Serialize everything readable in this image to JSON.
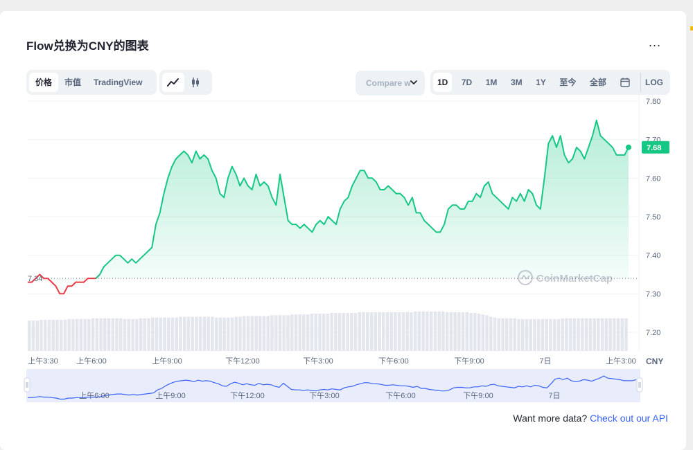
{
  "page": {
    "title": "Flow兑换为CNY的图表",
    "more_label": "..."
  },
  "tabs": [
    {
      "label": "价格",
      "active": true
    },
    {
      "label": "市值",
      "active": false
    },
    {
      "label": "TradingView",
      "active": false
    }
  ],
  "chart_types": [
    {
      "icon": "line-chart-icon",
      "active": true
    },
    {
      "icon": "candlestick-icon",
      "active": false
    }
  ],
  "compare": {
    "placeholder": "Compare w"
  },
  "ranges": [
    {
      "label": "1D",
      "active": true
    },
    {
      "label": "7D",
      "active": false
    },
    {
      "label": "1M",
      "active": false
    },
    {
      "label": "3M",
      "active": false
    },
    {
      "label": "1Y",
      "active": false
    },
    {
      "label": "至今",
      "active": false
    },
    {
      "label": "全部",
      "active": false
    },
    {
      "icon": "calendar-icon"
    },
    {
      "label": "LOG",
      "active": false
    }
  ],
  "colors": {
    "up": "#16c784",
    "down": "#ea3943",
    "nav_line": "#3861fb",
    "accent_link": "#3861fb"
  },
  "watermark": "CoinMarketCap",
  "api": {
    "text": "Want more data?",
    "link": "Check out our API"
  },
  "chart_data": {
    "type": "area",
    "currency": "CNY",
    "open_price": 7.34,
    "open_label": "7.34",
    "current_price": 7.68,
    "current_label": "7.68",
    "ylim": [
      7.16,
      7.82
    ],
    "yticks": [
      "7.80",
      "7.70",
      "7.60",
      "7.50",
      "7.40",
      "7.30",
      "7.20"
    ],
    "xticks": [
      "上午3:30",
      "上午6:00",
      "上午9:00",
      "下午12:00",
      "下午3:00",
      "下午6:00",
      "下午9:00",
      "7日",
      "上午3:00"
    ],
    "nav_xticks": [
      "上午6:00",
      "上午9:00",
      "下午12:00",
      "下午3:00",
      "下午6:00",
      "下午9:00",
      "7日"
    ],
    "series": [
      {
        "values": [
          7.33,
          7.33,
          7.34,
          7.35,
          7.34,
          7.34,
          7.33,
          7.32,
          7.3,
          7.3,
          7.32,
          7.32,
          7.33,
          7.33,
          7.33,
          7.34,
          7.34,
          7.34,
          7.35,
          7.37,
          7.38,
          7.39,
          7.4,
          7.4,
          7.39,
          7.38,
          7.39,
          7.38,
          7.39,
          7.4,
          7.41,
          7.42,
          7.48,
          7.51,
          7.56,
          7.6,
          7.63,
          7.65,
          7.66,
          7.67,
          7.66,
          7.64,
          7.67,
          7.65,
          7.66,
          7.65,
          7.62,
          7.6,
          7.56,
          7.55,
          7.6,
          7.63,
          7.61,
          7.58,
          7.6,
          7.58,
          7.57,
          7.61,
          7.58,
          7.59,
          7.58,
          7.55,
          7.53,
          7.61,
          7.55,
          7.49,
          7.48,
          7.48,
          7.47,
          7.48,
          7.47,
          7.46,
          7.48,
          7.49,
          7.48,
          7.5,
          7.49,
          7.48,
          7.52,
          7.54,
          7.55,
          7.58,
          7.6,
          7.62,
          7.62,
          7.6,
          7.6,
          7.59,
          7.57,
          7.57,
          7.58,
          7.57,
          7.56,
          7.56,
          7.55,
          7.53,
          7.55,
          7.51,
          7.51,
          7.49,
          7.48,
          7.47,
          7.46,
          7.46,
          7.48,
          7.52,
          7.53,
          7.53,
          7.52,
          7.52,
          7.54,
          7.54,
          7.56,
          7.55,
          7.58,
          7.59,
          7.56,
          7.55,
          7.54,
          7.53,
          7.52,
          7.55,
          7.54,
          7.56,
          7.54,
          7.57,
          7.56,
          7.53,
          7.52,
          7.6,
          7.69,
          7.71,
          7.68,
          7.71,
          7.66,
          7.64,
          7.65,
          7.68,
          7.67,
          7.65,
          7.68,
          7.71,
          7.75,
          7.71,
          7.7,
          7.69,
          7.68,
          7.66,
          7.66,
          7.66,
          7.68
        ]
      }
    ],
    "volume": [
      0.4,
      0.4,
      0.4,
      0.41,
      0.41,
      0.41,
      0.41,
      0.41,
      0.41,
      0.41,
      0.42,
      0.42,
      0.42,
      0.42,
      0.42,
      0.42,
      0.43,
      0.43,
      0.43,
      0.43,
      0.43,
      0.43,
      0.43,
      0.43,
      0.42,
      0.42,
      0.42,
      0.42,
      0.43,
      0.43,
      0.43,
      0.44,
      0.44,
      0.44,
      0.44,
      0.44,
      0.44,
      0.44,
      0.45,
      0.45,
      0.45,
      0.45,
      0.45,
      0.45,
      0.45,
      0.45,
      0.45,
      0.44,
      0.44,
      0.44,
      0.44,
      0.44,
      0.45,
      0.45,
      0.46,
      0.46,
      0.46,
      0.46,
      0.46,
      0.46,
      0.46,
      0.47,
      0.47,
      0.47,
      0.47,
      0.47,
      0.48,
      0.48,
      0.48,
      0.48,
      0.48,
      0.49,
      0.49,
      0.49,
      0.49,
      0.49,
      0.5,
      0.5,
      0.5,
      0.5,
      0.5,
      0.5,
      0.5,
      0.51,
      0.51,
      0.51,
      0.51,
      0.51,
      0.51,
      0.51,
      0.51,
      0.51,
      0.51,
      0.51,
      0.51,
      0.51,
      0.51,
      0.52,
      0.52,
      0.52,
      0.52,
      0.52,
      0.52,
      0.52,
      0.52,
      0.51,
      0.51,
      0.51,
      0.51,
      0.51,
      0.51,
      0.5,
      0.5,
      0.49,
      0.48,
      0.47,
      0.45,
      0.44,
      0.43,
      0.43,
      0.43,
      0.43,
      0.43,
      0.42,
      0.42,
      0.42,
      0.42,
      0.42,
      0.42,
      0.42,
      0.42,
      0.42,
      0.42,
      0.42,
      0.43,
      0.43,
      0.43,
      0.43,
      0.43,
      0.43,
      0.43,
      0.43,
      0.43,
      0.43,
      0.43,
      0.43,
      0.43,
      0.43,
      0.43,
      0.43,
      0.43
    ]
  }
}
